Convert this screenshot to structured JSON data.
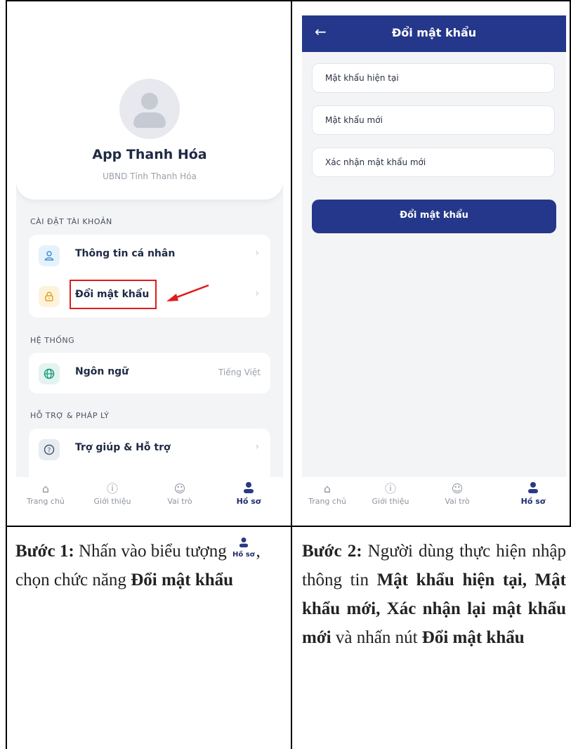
{
  "step1_screen": {
    "app_name": "App Thanh Hóa",
    "app_subtitle": "UBND Tỉnh Thanh Hóa",
    "sections": [
      {
        "title": "CÀI ĐẶT TÀI KHOẢN"
      },
      {
        "title": "HỆ THỐNG"
      },
      {
        "title": "HỖ TRỢ & PHÁP LÝ"
      }
    ],
    "items": {
      "personal_info": {
        "label": "Thông tin cá nhân",
        "icon": "user-icon"
      },
      "change_password": {
        "label": "Đổi mật khẩu",
        "icon": "lock-icon"
      },
      "language": {
        "label": "Ngôn ngữ",
        "value": "Tiếng Việt",
        "icon": "globe-icon"
      },
      "help": {
        "label": "Trợ giúp & Hỗ trợ",
        "icon": "help-icon"
      }
    },
    "annotation_color": "#e01b1b"
  },
  "step2_screen": {
    "title": "Đổi mật khẩu",
    "fields": {
      "current": "Mật khẩu hiện tại",
      "new": "Mật khẩu mới",
      "confirm": "Xác nhận mật khẩu mới"
    },
    "submit_label": "Đổi mật khẩu"
  },
  "tabs": {
    "home": "Trang chủ",
    "about": "Giới thiệu",
    "role": "Vai trò",
    "profile": "Hồ sơ"
  },
  "colors": {
    "primary": "#24378a"
  },
  "captions": {
    "step1": {
      "bold_prefix": "Bước 1:",
      "text1": " Nhấn vào biểu tượng ",
      "text2": ", chọn chức năng ",
      "bold_end": "Đổi mật khẩu"
    },
    "step2": {
      "bold_prefix": "Bước 2:",
      "text1": " Người dùng thực hiện nhập thông tin ",
      "bold_fields": "Mật khẩu hiện tại, Mật khẩu mới, Xác nhận lại mật khẩu mới",
      "text2": " và nhấn nút ",
      "bold_end": "Đổi mật khẩu"
    }
  }
}
